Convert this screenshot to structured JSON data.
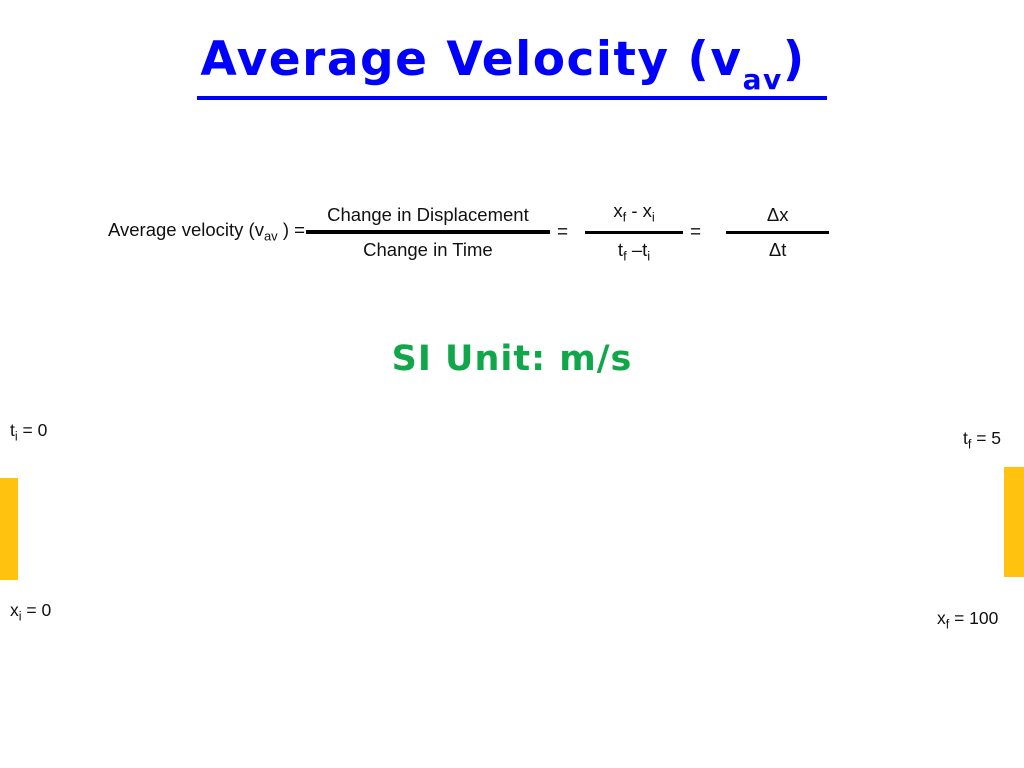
{
  "slide": {
    "title": {
      "main": "Average Velocity (v",
      "subscript": "av",
      "tail": ") "
    },
    "colors": {
      "title": "#0000FF",
      "si_unit": "#10A64A",
      "bar": "#FFC20E",
      "text": "#111111",
      "background": "#FFFFFF"
    },
    "formula": {
      "lead_label_main": "Average velocity (v",
      "lead_label_sub": "av",
      "lead_label_tail": " ) =",
      "fraction_1": {
        "numerator": "Change in Displacement",
        "denominator": "Change in Time"
      },
      "equals_1": "=",
      "fraction_2": {
        "numerator_x1": "x",
        "numerator_sub1": "f",
        "numerator_mid": " - x",
        "numerator_sub2": "i",
        "denominator_t1": "t",
        "denominator_sub1": "f",
        "denominator_mid": " –t",
        "denominator_sub2": "i"
      },
      "equals_2": "=",
      "fraction_3": {
        "numerator": "Δx",
        "denominator": "Δt"
      }
    },
    "si_unit": "SI Unit: m/s",
    "diagram": {
      "initial_time_label": "t",
      "initial_time_sub": "i",
      "initial_time_value": " = 0",
      "initial_pos_label": "x",
      "initial_pos_sub": "i",
      "initial_pos_value": " = 0",
      "final_time_label": "t",
      "final_time_sub": "f",
      "final_time_value": " = 5",
      "final_pos_label": "x",
      "final_pos_sub": "f",
      "final_pos_value": " = 100"
    }
  }
}
